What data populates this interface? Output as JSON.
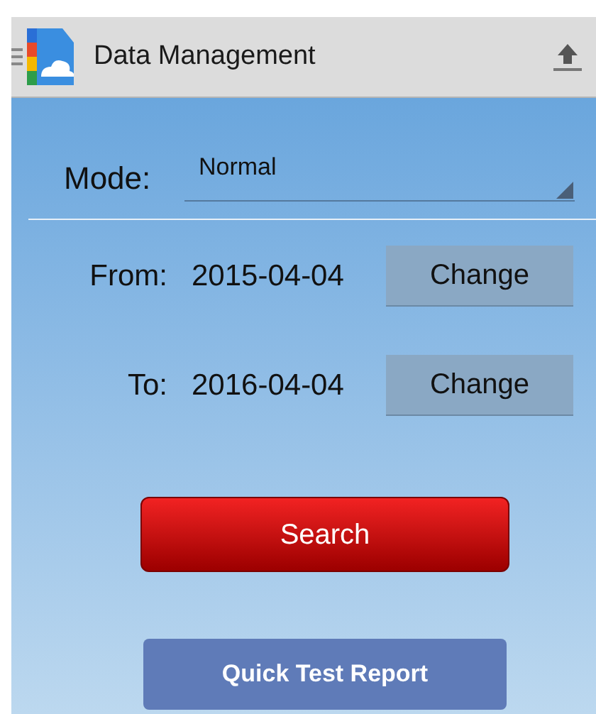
{
  "action_bar": {
    "title": "Data Management"
  },
  "mode": {
    "label": "Mode:",
    "value": "Normal"
  },
  "date_rows": [
    {
      "label": "From:",
      "value": "2015-04-04",
      "button": "Change"
    },
    {
      "label": "To:",
      "value": "2016-04-04",
      "button": "Change"
    }
  ],
  "buttons": [
    {
      "kind": "primary",
      "label": "Search"
    },
    {
      "kind": "secondary",
      "label": "Quick Test Report"
    }
  ]
}
